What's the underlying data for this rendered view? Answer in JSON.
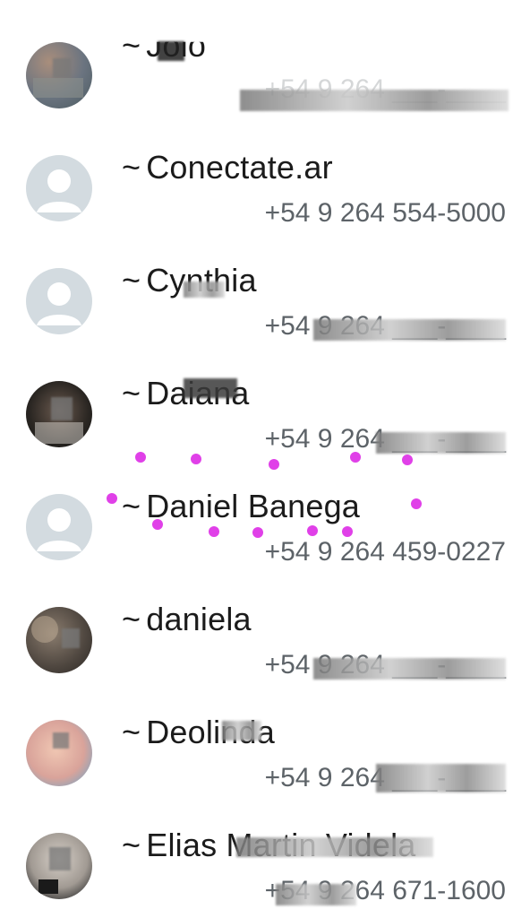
{
  "contacts": [
    {
      "prefix": "~",
      "name": "Jolo",
      "phone": "+54 9 264 ___-____",
      "avatar": "photo"
    },
    {
      "prefix": "~",
      "name": "Conectate.ar",
      "phone": "+54 9 264 554-5000",
      "avatar": "default"
    },
    {
      "prefix": "~",
      "name": "Cynthia",
      "phone": "+54 9 264 ___-____",
      "avatar": "default"
    },
    {
      "prefix": "~",
      "name": "Daiana",
      "phone": "+54 9 264 ___-____",
      "avatar": "photo"
    },
    {
      "prefix": "~",
      "name": "Daniel Banega",
      "phone": "+54 9 264 459-0227",
      "avatar": "default"
    },
    {
      "prefix": "~",
      "name": "daniela",
      "phone": "+54 9 264 ___-____",
      "avatar": "photo"
    },
    {
      "prefix": "~",
      "name": "Deolinda",
      "phone": "+54 9 264 ___-____",
      "avatar": "photo"
    },
    {
      "prefix": "~",
      "name": "Elias Martin Videla",
      "phone": "+54 9 264 671-1600",
      "avatar": "photo"
    }
  ],
  "colors": {
    "name_text": "#1b1b1b",
    "phone_text": "#5d6368",
    "default_avatar_bg": "#d3dbe0",
    "default_avatar_fg": "#ffffff",
    "annotation_dots": "#e040e8"
  },
  "icons": {
    "default_avatar": "person-silhouette-icon"
  }
}
